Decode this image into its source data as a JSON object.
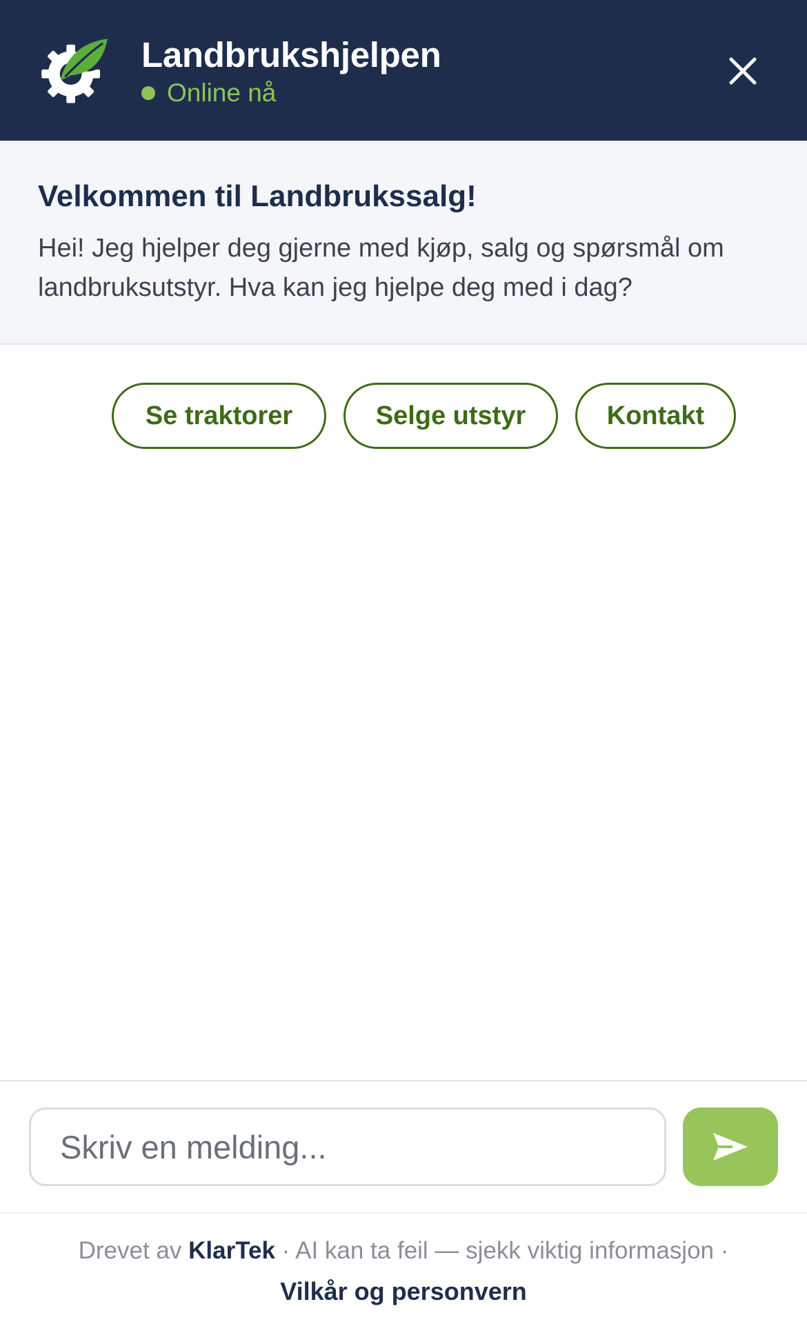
{
  "header": {
    "title": "Landbrukshjelpen",
    "status": "Online nå",
    "logo_icon": "gear-leaf-icon",
    "close_icon": "close-icon"
  },
  "welcome": {
    "title": "Velkommen til Landbrukssalg!",
    "text": "Hei! Jeg hjelper deg gjerne med kjøp, salg og spørsmål om landbruksutstyr. Hva kan jeg hjelpe deg med i dag?"
  },
  "quick_replies": [
    {
      "label": "Se traktorer"
    },
    {
      "label": "Selge utstyr"
    },
    {
      "label": "Kontakt"
    }
  ],
  "composer": {
    "placeholder": "Skriv en melding...",
    "value": "",
    "send_icon": "send-icon"
  },
  "footer": {
    "powered_prefix": "Drevet av",
    "powered_brand": "KlarTek",
    "disclaimer": "· AI kan ta feil — sjekk viktig informasjon ·",
    "terms_link": "Vilkår og personvern"
  },
  "colors": {
    "header_bg": "#1f2d4d",
    "accent_green": "#8dc453",
    "chip_green": "#3d6b17",
    "send_green": "#98c55a",
    "welcome_bg": "#f4f6f9"
  }
}
